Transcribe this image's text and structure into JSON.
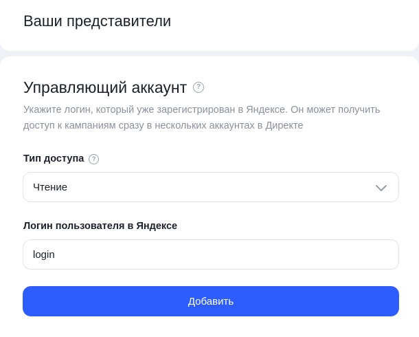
{
  "representatives": {
    "title": "Ваши представители"
  },
  "managing_account": {
    "heading": "Управляющий аккаунт",
    "help_glyph": "?",
    "description": "Укажите логин, который уже зарегистрирован в Яндексе. Он может получить доступ к кампаниям сразу в нескольких аккаунтах в Директе",
    "access_type": {
      "label": "Тип доступа",
      "help_glyph": "?",
      "selected_value": "Чтение",
      "icon": "chevron-down-icon"
    },
    "login": {
      "label": "Логин пользователя в Яндексе",
      "value": "login"
    },
    "add_button": {
      "label": "Добавить"
    }
  },
  "colors": {
    "accent": "#2d5cff",
    "background": "#eef1f6",
    "muted_text": "#8a909c",
    "border": "#dfe3ea"
  }
}
